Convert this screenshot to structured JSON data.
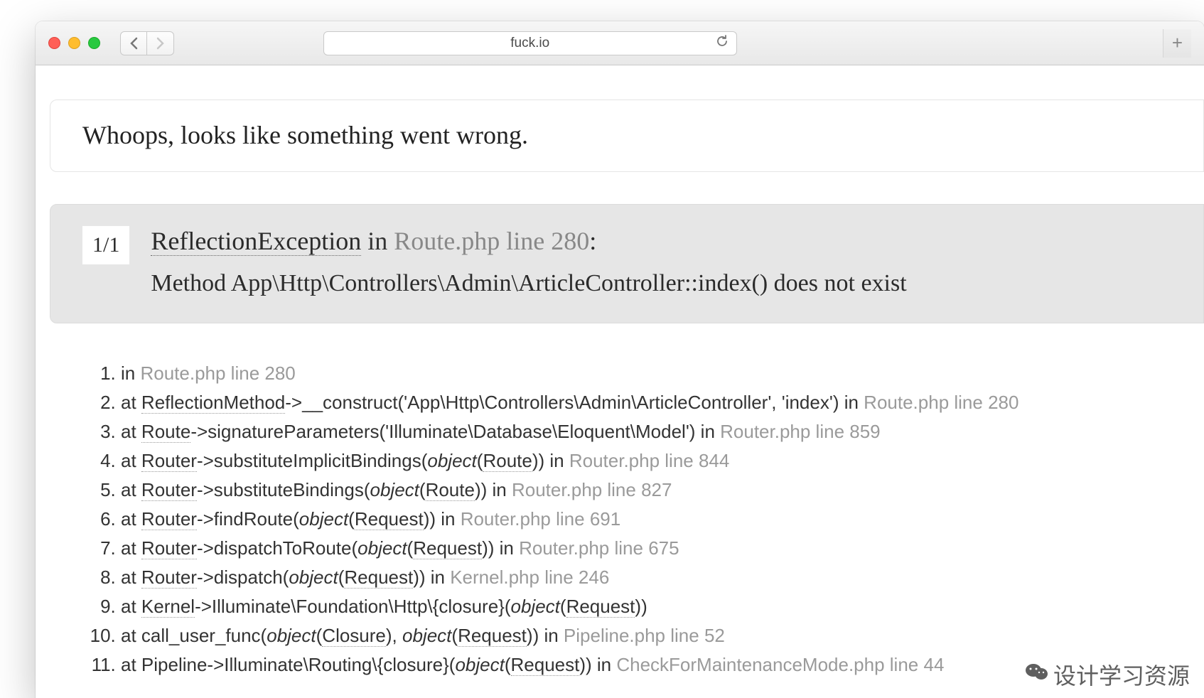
{
  "browser": {
    "url": "fuck.io"
  },
  "page": {
    "heading": "Whoops, looks like something went wrong."
  },
  "exception": {
    "counter": "1/1",
    "name": "ReflectionException",
    "in_word": " in ",
    "file": "Route.php line 280",
    "colon": ":",
    "message": "Method App\\Http\\Controllers\\Admin\\ArticleController::index() does not exist"
  },
  "trace": [
    {
      "prefix": "in ",
      "file": "Route.php line 280"
    },
    {
      "prefix": "at ",
      "cls": "ReflectionMethod",
      "arrow": "->__construct('App\\Http\\Controllers\\Admin\\ArticleController', 'index') in ",
      "file": "Route.php line 280"
    },
    {
      "prefix": "at ",
      "cls": "Route",
      "arrow": "->signatureParameters('Illuminate\\Database\\Eloquent\\Model') in ",
      "file": "Router.php line 859"
    },
    {
      "prefix": "at ",
      "cls": "Router",
      "arrow": "->substituteImplicitBindings(",
      "obj": "object",
      "lp": "(",
      "arg": "Route",
      "rp": "))",
      "in": " in ",
      "file": "Router.php line 844"
    },
    {
      "prefix": "at ",
      "cls": "Router",
      "arrow": "->substituteBindings(",
      "obj": "object",
      "lp": "(",
      "arg": "Route",
      "rp": "))",
      "in": " in ",
      "file": "Router.php line 827"
    },
    {
      "prefix": "at ",
      "cls": "Router",
      "arrow": "->findRoute(",
      "obj": "object",
      "lp": "(",
      "arg": "Request",
      "rp": "))",
      "in": " in ",
      "file": "Router.php line 691"
    },
    {
      "prefix": "at ",
      "cls": "Router",
      "arrow": "->dispatchToRoute(",
      "obj": "object",
      "lp": "(",
      "arg": "Request",
      "rp": "))",
      "in": " in ",
      "file": "Router.php line 675"
    },
    {
      "prefix": "at ",
      "cls": "Router",
      "arrow": "->dispatch(",
      "obj": "object",
      "lp": "(",
      "arg": "Request",
      "rp": "))",
      "in": " in ",
      "file": "Kernel.php line 246"
    },
    {
      "prefix": "at ",
      "cls": "Kernel",
      "arrow": "->Illuminate\\Foundation\\Http\\{closure}(",
      "obj": "object",
      "lp": "(",
      "arg": "Request",
      "rp": "))"
    },
    {
      "prefix": "at call_user_func(",
      "obj": "object",
      "lp": "(",
      "arg": "Closure",
      "rp": ")",
      "comma": ", ",
      "obj2": "object",
      "lp2": "(",
      "arg2": "Request",
      "rp2": "))",
      "in": " in ",
      "file": "Pipeline.php line 52"
    },
    {
      "prefix": "at Pipeline->Illuminate\\Routing\\{closure}(",
      "obj": "object",
      "lp": "(",
      "arg": "Request",
      "rp": "))",
      "in": " in ",
      "file": "CheckForMaintenanceMode.php line 44"
    }
  ],
  "watermark": {
    "text": "设计学习资源"
  }
}
